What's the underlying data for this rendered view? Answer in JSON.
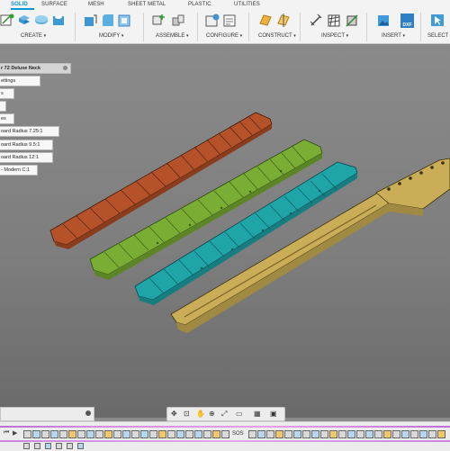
{
  "ribbon": {
    "tabs": [
      {
        "label": "SOLID",
        "active": true
      },
      {
        "label": "SURFACE"
      },
      {
        "label": "MESH"
      },
      {
        "label": "SHEET METAL"
      },
      {
        "label": "PLASTIC"
      },
      {
        "label": "UTILITIES"
      }
    ],
    "groups": {
      "create": "CREATE",
      "modify": "MODIFY",
      "assemble": "ASSEMBLE",
      "configure": "CONFIGURE",
      "construct": "CONSTRUCT",
      "inspect": "INSPECT",
      "insert": "INSERT",
      "select": "SELECT"
    },
    "insert_dxf_label": "DXF",
    "accent": "#0696d7"
  },
  "browser": {
    "root": "r 72 Deluxe Neck",
    "items": [
      "ettings",
      "s",
      "",
      "es",
      "oard Radius 7.25:1",
      "oard Radius 9.5:1",
      "oard Radius 12:1",
      "- Modern C:1"
    ]
  },
  "timeline": {
    "timeline_label": "SOS"
  },
  "colors": {
    "fretboard_1": "#b5522a",
    "fretboard_2": "#7aad34",
    "fretboard_3": "#1fa5a8",
    "neck": "#c9ad57"
  }
}
